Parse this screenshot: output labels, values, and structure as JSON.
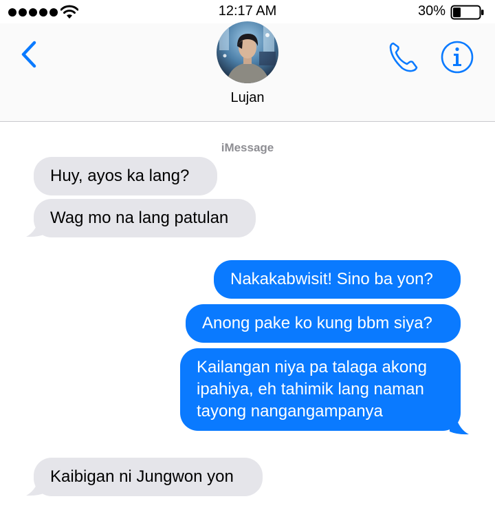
{
  "status_bar": {
    "time": "12:17 AM",
    "battery_percent": "30%",
    "signal_bars": 5,
    "wifi_icon": "wifi-icon",
    "battery_level": 0.3
  },
  "header": {
    "contact_name": "Lujan",
    "back_icon": "chevron-left-icon",
    "call_icon": "phone-icon",
    "info_icon": "info-icon"
  },
  "conversation": {
    "service_label": "iMessage",
    "messages": [
      {
        "direction": "incoming",
        "text": "Huy, ayos ka lang?"
      },
      {
        "direction": "incoming",
        "text": "Wag mo na lang patulan"
      },
      {
        "direction": "outgoing",
        "text": "Nakakabwisit! Sino ba yon?"
      },
      {
        "direction": "outgoing",
        "text": "Anong pake ko kung bbm siya?"
      },
      {
        "direction": "outgoing",
        "text": "Kailangan niya pa talaga akong ipahiya, eh tahimik lang naman tayong nangangampanya"
      },
      {
        "direction": "incoming",
        "text": "Kaibigan ni Jungwon yon"
      }
    ]
  },
  "colors": {
    "accent": "#0a7aff",
    "incoming_bubble": "#e5e5ea",
    "outgoing_bubble": "#0a7aff",
    "header_bg": "#fafafa",
    "service_label": "#8e8e93"
  }
}
